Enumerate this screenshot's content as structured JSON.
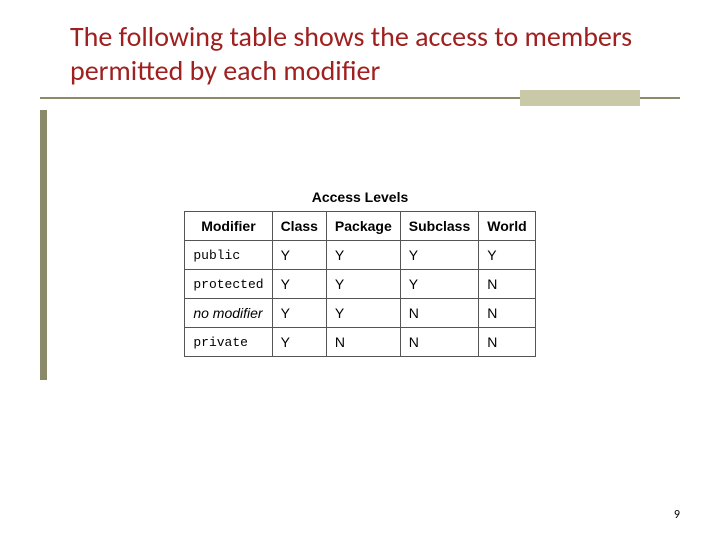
{
  "title": "The following table shows the access to members permitted by each modifier",
  "table": {
    "caption": "Access Levels",
    "headers": [
      "Modifier",
      "Class",
      "Package",
      "Subclass",
      "World"
    ],
    "rows": [
      {
        "modifier": "public",
        "mono": true,
        "italic": false,
        "cells": [
          "Y",
          "Y",
          "Y",
          "Y"
        ]
      },
      {
        "modifier": "protected",
        "mono": true,
        "italic": false,
        "cells": [
          "Y",
          "Y",
          "Y",
          "N"
        ]
      },
      {
        "modifier": "no modifier",
        "mono": false,
        "italic": true,
        "cells": [
          "Y",
          "Y",
          "N",
          "N"
        ]
      },
      {
        "modifier": "private",
        "mono": true,
        "italic": false,
        "cells": [
          "Y",
          "N",
          "N",
          "N"
        ]
      }
    ]
  },
  "page_number": "9",
  "chart_data": {
    "type": "table",
    "title": "Access Levels",
    "columns": [
      "Modifier",
      "Class",
      "Package",
      "Subclass",
      "World"
    ],
    "rows": [
      [
        "public",
        "Y",
        "Y",
        "Y",
        "Y"
      ],
      [
        "protected",
        "Y",
        "Y",
        "Y",
        "N"
      ],
      [
        "no modifier",
        "Y",
        "Y",
        "N",
        "N"
      ],
      [
        "private",
        "Y",
        "N",
        "N",
        "N"
      ]
    ]
  }
}
